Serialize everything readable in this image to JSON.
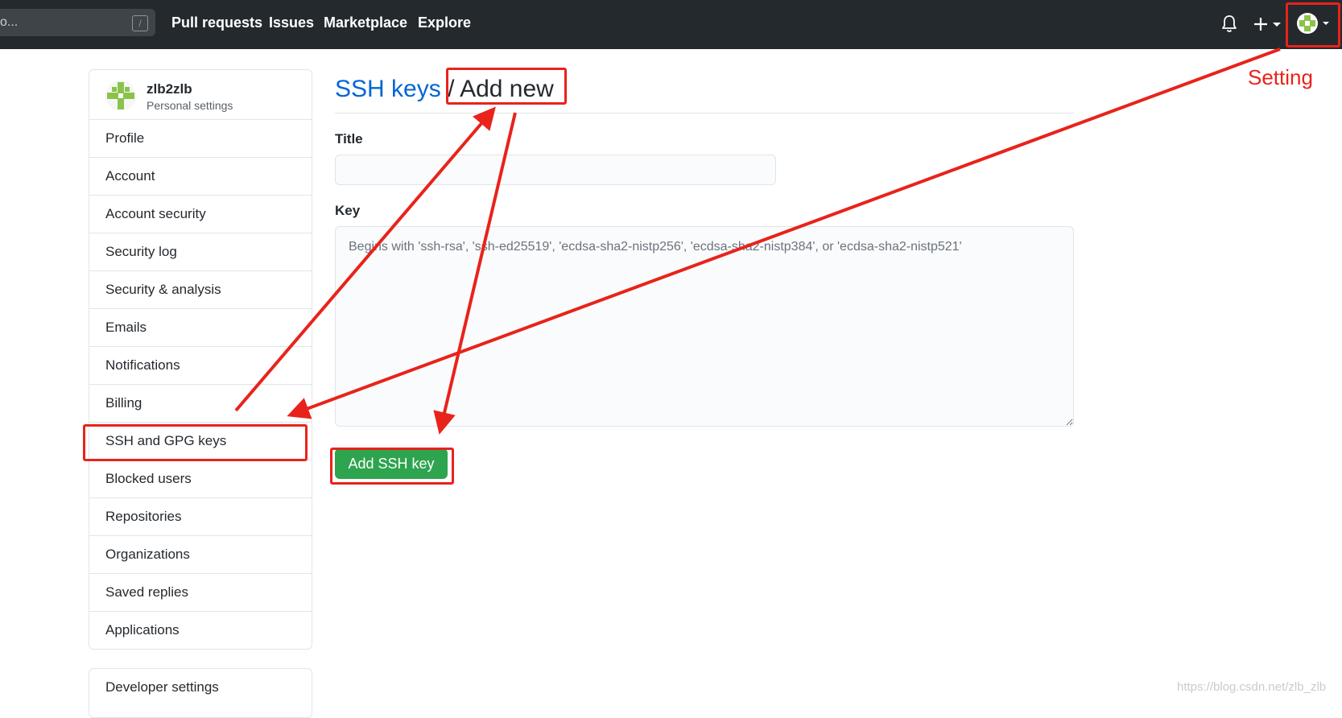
{
  "header": {
    "search_text": "o...",
    "search_shortcut": "/",
    "nav": [
      "Pull requests",
      "Issues",
      "Marketplace",
      "Explore"
    ]
  },
  "sidebar": {
    "username": "zlb2zlb",
    "subtitle": "Personal settings",
    "items": [
      {
        "label": "Profile"
      },
      {
        "label": "Account"
      },
      {
        "label": "Account security"
      },
      {
        "label": "Security log"
      },
      {
        "label": "Security & analysis"
      },
      {
        "label": "Emails"
      },
      {
        "label": "Notifications"
      },
      {
        "label": "Billing"
      },
      {
        "label": "SSH and GPG keys"
      },
      {
        "label": "Blocked users"
      },
      {
        "label": "Repositories"
      },
      {
        "label": "Organizations"
      },
      {
        "label": "Saved replies"
      },
      {
        "label": "Applications"
      }
    ],
    "developer_settings": "Developer settings"
  },
  "main": {
    "breadcrumb_link": "SSH keys",
    "breadcrumb_sep": "/",
    "breadcrumb_current": "Add new",
    "title_label": "Title",
    "title_value": "",
    "key_label": "Key",
    "key_placeholder": "Begins with 'ssh-rsa', 'ssh-ed25519', 'ecdsa-sha2-nistp256', 'ecdsa-sha2-nistp384', or 'ecdsa-sha2-nistp521'",
    "submit_label": "Add SSH key"
  },
  "annotations": {
    "setting_label": "Setting",
    "color": "#e8231b"
  },
  "watermark": "https://blog.csdn.net/zlb_zlb",
  "colors": {
    "header_bg": "#24292e",
    "link": "#0366d6",
    "primary_button": "#2ea44f"
  }
}
